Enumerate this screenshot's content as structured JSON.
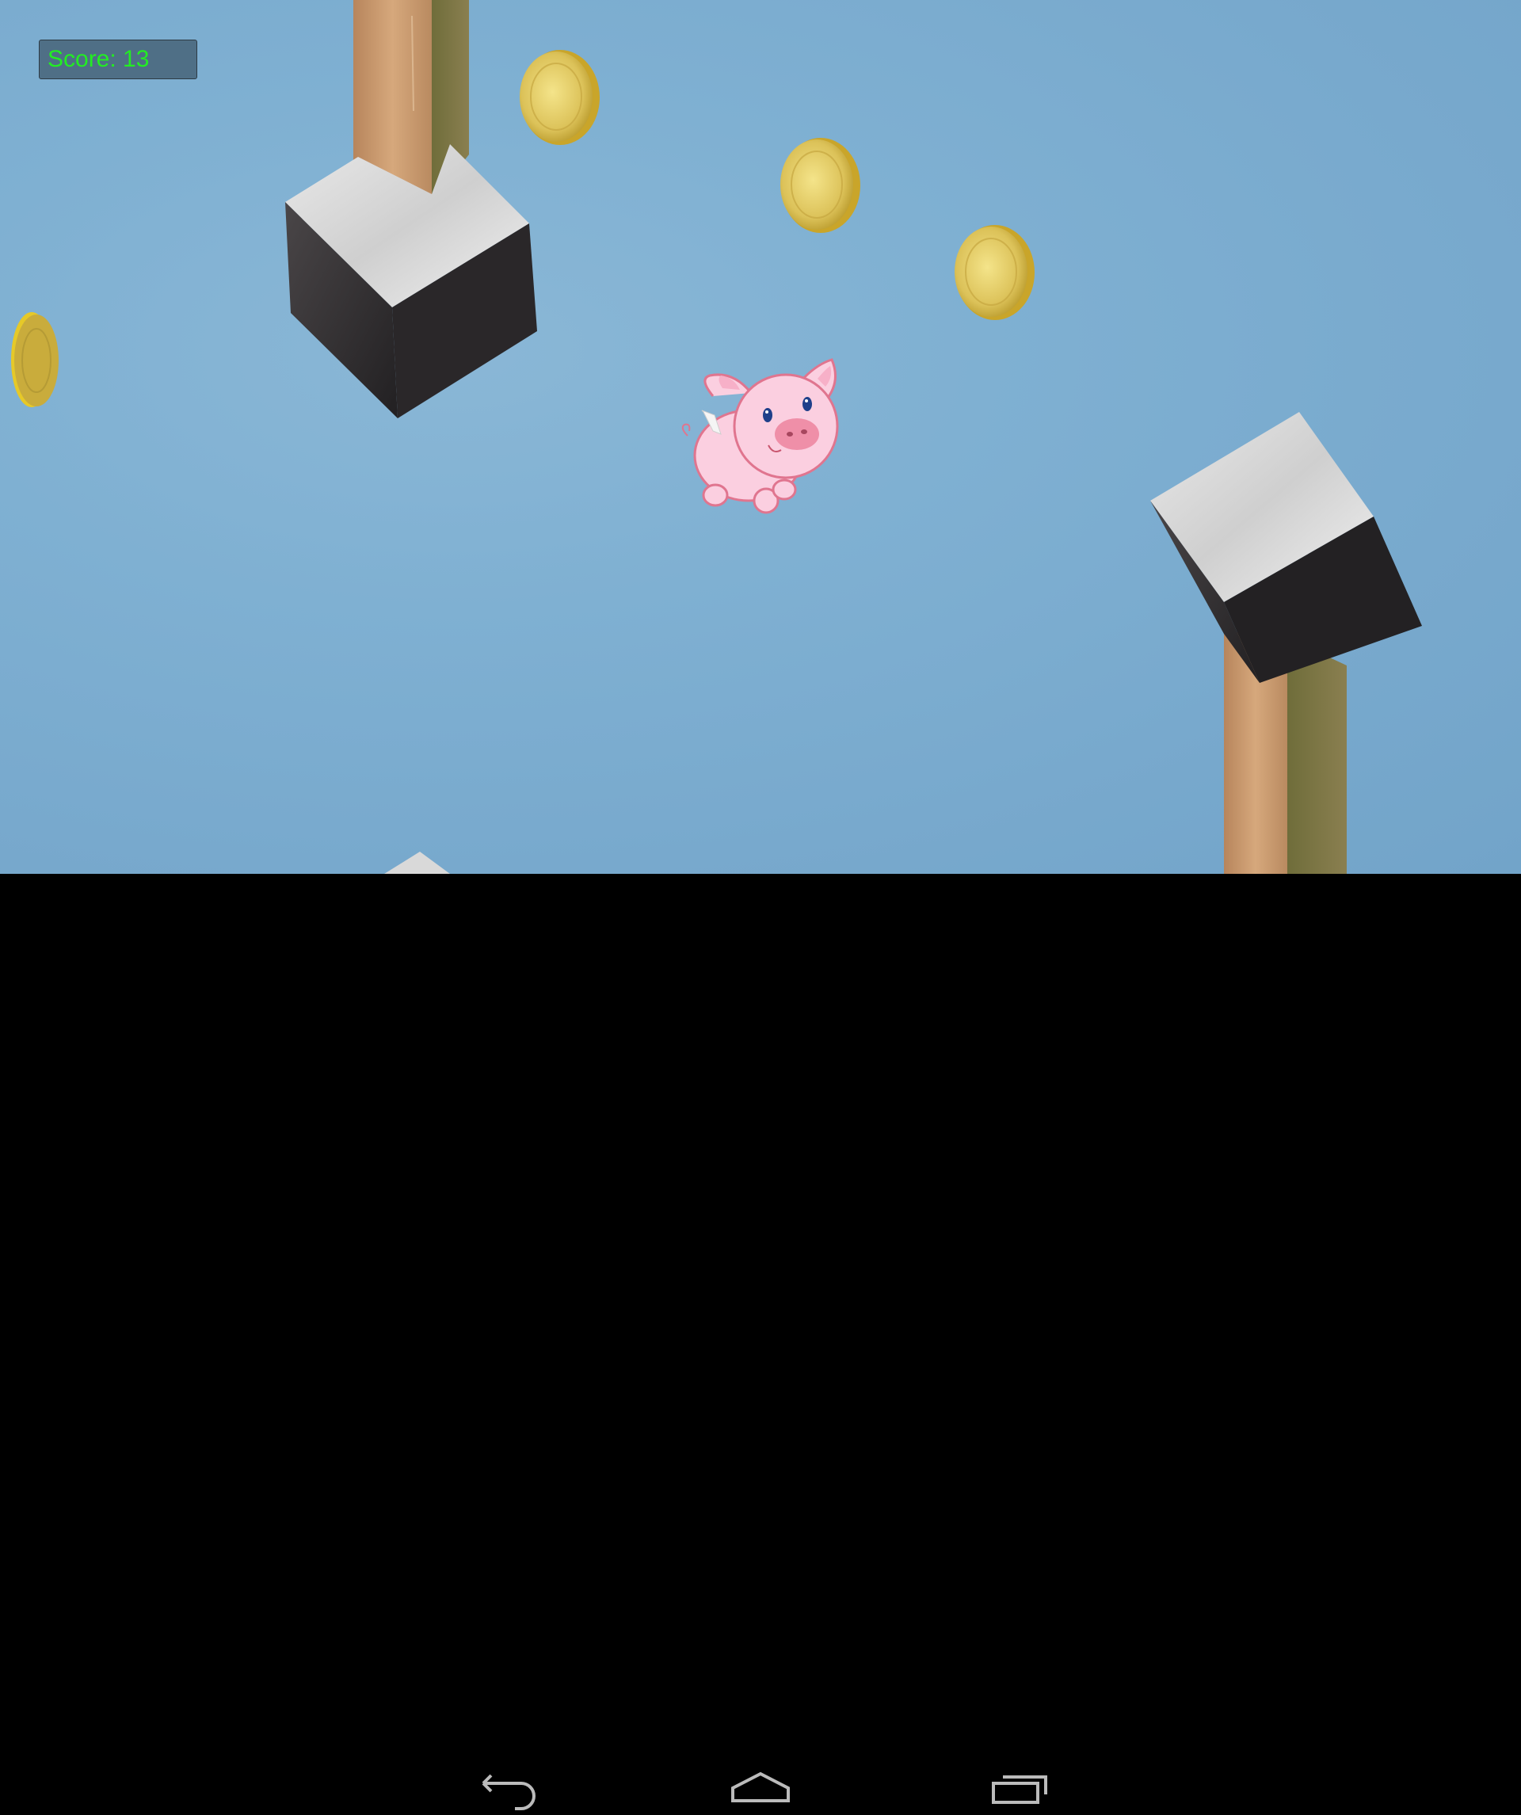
{
  "hud": {
    "score_label": "Score: 13",
    "score_text_color": "#22ee22",
    "score_box_color": "#4f6f86"
  },
  "game": {
    "sky_color": "#7fb0d2",
    "player": "winged-pink-pig",
    "player_color": "#fbcfe0",
    "obstacles": [
      "wooden-post-with-marble-cube-top",
      "wooden-post-with-marble-cube-bottom",
      "marble-cube-partial-bottom"
    ],
    "collectibles": [
      "gold-coin",
      "gold-coin",
      "gold-coin",
      "gold-coin"
    ]
  },
  "navbar": {
    "buttons": [
      {
        "icon": "back-icon"
      },
      {
        "icon": "home-icon"
      },
      {
        "icon": "recent-apps-icon"
      }
    ]
  }
}
